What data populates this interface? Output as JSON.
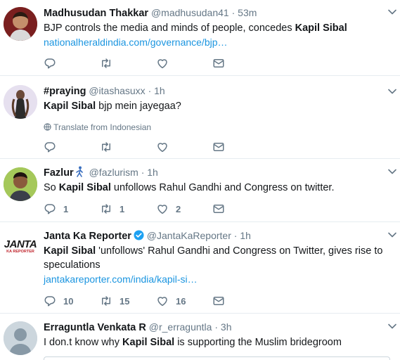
{
  "colors": {
    "accent": "#1b95e0",
    "secondary": "#657786",
    "divider": "#e6ecf0",
    "verified": "#1da1f2"
  },
  "tweets": [
    {
      "fullname": "Madhusudan Thakkar",
      "username": "@madhusudan41",
      "time": "53m",
      "text_before": "BJP controls the media and minds of people, concedes ",
      "text_bold": "Kapil Sibal",
      "text_after": "",
      "link": "nationalheraldindia.com/governance/bjp…",
      "reply_count": "",
      "retweet_count": "",
      "like_count": ""
    },
    {
      "fullname": "#praying",
      "username": "@itashasuxx",
      "time": "1h",
      "text_before": "",
      "text_bold": "Kapil Sibal",
      "text_after": " bjp mein jayegaa?",
      "translate": "Translate from Indonesian",
      "reply_count": "",
      "retweet_count": "",
      "like_count": ""
    },
    {
      "fullname": "Fazlur",
      "username": "@fazlurism",
      "time": "1h",
      "text_before": "So ",
      "text_bold": "Kapil Sibal",
      "text_after": " unfollows Rahul Gandhi and Congress on twitter.",
      "reply_count": "1",
      "retweet_count": "1",
      "like_count": "2"
    },
    {
      "fullname": "Janta Ka Reporter",
      "username": "@JantaKaReporter",
      "time": "1h",
      "avatar_text": "JANTA",
      "avatar_subtext": "KA REPORTER",
      "text_before": "",
      "text_bold": "Kapil Sibal",
      "text_after": " 'unfollows' Rahul Gandhi and Congress on Twitter, gives rise to speculations",
      "link": "jantakareporter.com/india/kapil-si…",
      "reply_count": "10",
      "retweet_count": "15",
      "like_count": "16"
    },
    {
      "fullname": "Erraguntla Venkata R",
      "username": "@r_erraguntla",
      "time": "3h",
      "text_before": "I don.t know why ",
      "text_bold": "Kapil Sibal",
      "text_after": " is supporting the Muslim bridegroom"
    }
  ],
  "separator": "·"
}
